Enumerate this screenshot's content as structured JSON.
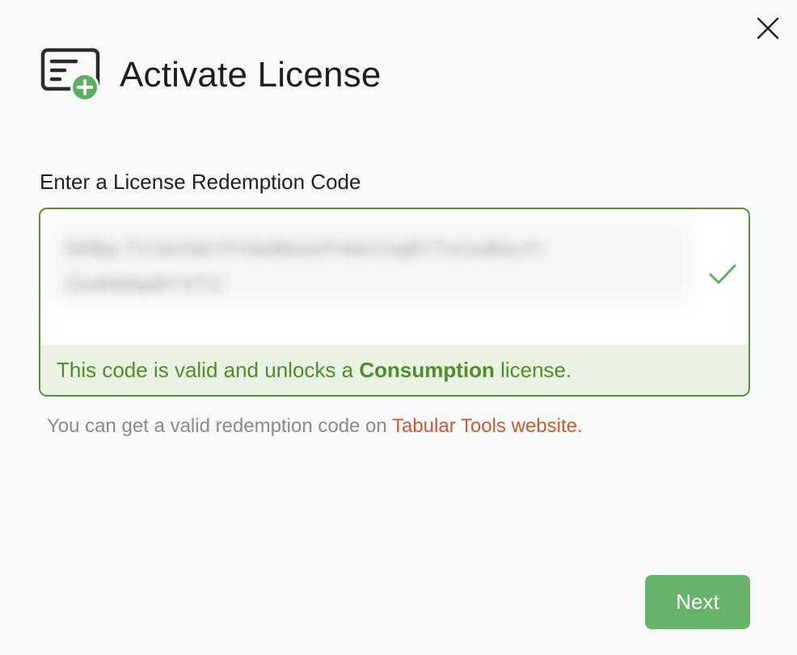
{
  "dialog": {
    "title": "Activate License",
    "close_icon": "close-icon",
    "header_icon": "license-add-icon",
    "accent_color": "#68b36a"
  },
  "form": {
    "label": "Enter a License Redemption Code",
    "code_value_line1": "N0Bp-TV1bVbbYFHbdbkosPHbh1nqBYTnUuBbuYl",
    "code_value_line2": "GzdNbbpBYXTU",
    "status_icon": "check-icon",
    "validation": {
      "prefix": "This code is valid and unlocks a ",
      "license_type": "Consumption",
      "suffix": " license.",
      "color": "#4f8d2c",
      "background": "#e9f2e3"
    }
  },
  "hint": {
    "text": "You can get a valid redemption code on ",
    "link_text": "Tabular Tools website.",
    "link_color": "#cc5a2e"
  },
  "footer": {
    "next_label": "Next"
  }
}
